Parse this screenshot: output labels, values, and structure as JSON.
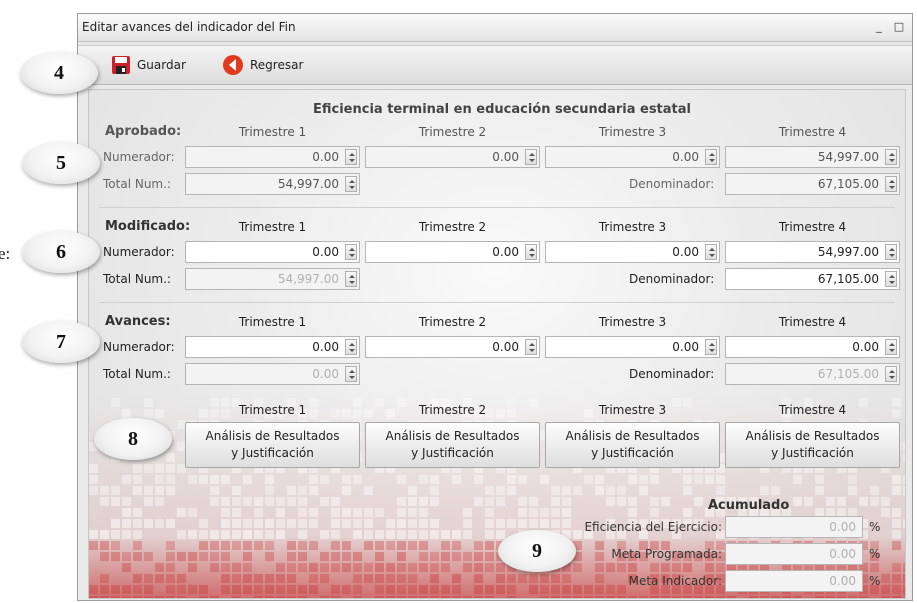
{
  "stray_text": "e:",
  "window": {
    "title": "Editar avances del indicador del Fin",
    "minimize": "_",
    "maximize": "□"
  },
  "toolbar": {
    "save_label": "Guardar",
    "back_label": "Regresar"
  },
  "indicator_title": "Eficiencia terminal  en educación  secundaria estatal",
  "quarters": [
    "Trimestre 1",
    "Trimestre 2",
    "Trimestre 3",
    "Trimestre 4"
  ],
  "row_labels": {
    "numerador": "Numerador:",
    "total_num": "Total Num.:",
    "denominador": "Denominador:"
  },
  "aprobado": {
    "label": "Aprobado:",
    "numerador": [
      "0.00",
      "0.00",
      "0.00",
      "54,997.00"
    ],
    "total_num": "54,997.00",
    "denominador": "67,105.00"
  },
  "modificado": {
    "label": "Modificado:",
    "numerador": [
      "0.00",
      "0.00",
      "0.00",
      "54,997.00"
    ],
    "total_num": "54,997.00",
    "denominador": "67,105.00"
  },
  "avances": {
    "label": "Avances:",
    "numerador": [
      "0.00",
      "0.00",
      "0.00",
      "0.00"
    ],
    "total_num": "0.00",
    "denominador": "67,105.00"
  },
  "analysis": {
    "line1": "Análisis de Resultados",
    "line2": "y Justificación"
  },
  "acumulado": {
    "title": "Acumulado",
    "eficiencia_label": "Eficiencia del Ejercicio:",
    "eficiencia_value": "0.00",
    "meta_programada_label": "Meta Programada:",
    "meta_programada_value": "0.00",
    "meta_indicador_label": "Meta Indicador:",
    "meta_indicador_value": "0.00",
    "unit": "%"
  },
  "callouts": [
    "4",
    "5",
    "6",
    "7",
    "8",
    "9"
  ],
  "colors": {
    "save_icon": "#d0202a",
    "back_icon": "#e23a1e",
    "footer_red": "#c83c3c"
  }
}
